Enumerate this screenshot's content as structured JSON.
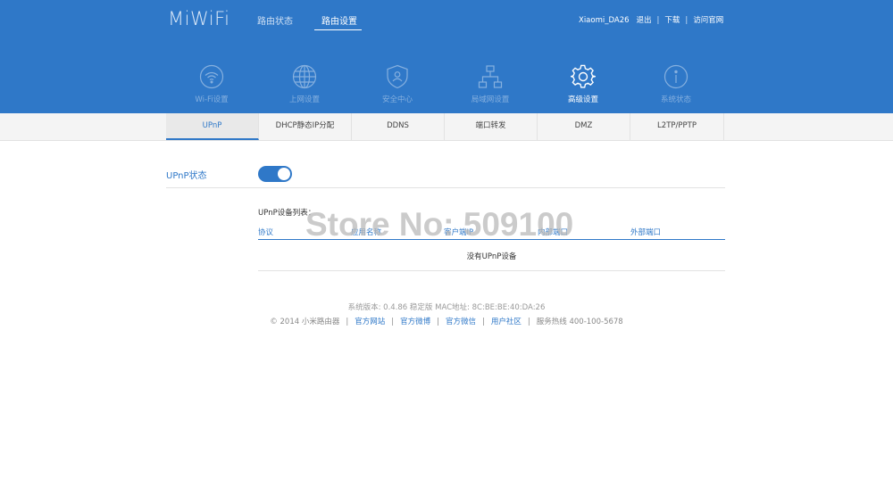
{
  "header": {
    "logo": "MiWiFi",
    "nav": [
      {
        "label": "路由状态",
        "active": false
      },
      {
        "label": "路由设置",
        "active": true
      }
    ],
    "user": {
      "device": "Xiaomi_DA26",
      "logout": "退出",
      "download": "下载",
      "official_site": "访问官网"
    },
    "categories": [
      {
        "label": "Wi-Fi设置",
        "icon": "wifi-icon",
        "active": false
      },
      {
        "label": "上网设置",
        "icon": "globe-icon",
        "active": false
      },
      {
        "label": "安全中心",
        "icon": "shield-icon",
        "active": false
      },
      {
        "label": "局域网设置",
        "icon": "lan-icon",
        "active": false
      },
      {
        "label": "高级设置",
        "icon": "gear-icon",
        "active": true
      },
      {
        "label": "系统状态",
        "icon": "info-icon",
        "active": false
      }
    ],
    "colors": {
      "header_bg": "#2f78c8",
      "accent": "#2f78c8"
    }
  },
  "subtabs": [
    {
      "label": "UPnP",
      "active": true
    },
    {
      "label": "DHCP静态IP分配",
      "active": false
    },
    {
      "label": "DDNS",
      "active": false
    },
    {
      "label": "端口转发",
      "active": false
    },
    {
      "label": "DMZ",
      "active": false
    },
    {
      "label": "L2TP/PPTP",
      "active": false
    }
  ],
  "upnp": {
    "status_label": "UPnP状态",
    "enabled": true,
    "list_title": "UPnP设备列表：",
    "columns": [
      "协议",
      "应用名称",
      "客户端IP",
      "内部端口",
      "外部端口"
    ],
    "empty_text": "没有UPnP设备"
  },
  "footer": {
    "version_line": "系统版本: 0.4.86 稳定版   MAC地址: 8C:BE:BE:40:DA:26",
    "copyright": "© 2014 小米路由器",
    "links": [
      "官方网站",
      "官方微博",
      "官方微信",
      "用户社区"
    ],
    "hotline": "服务热线 400-100-5678"
  },
  "watermark": "Store No: 509100"
}
